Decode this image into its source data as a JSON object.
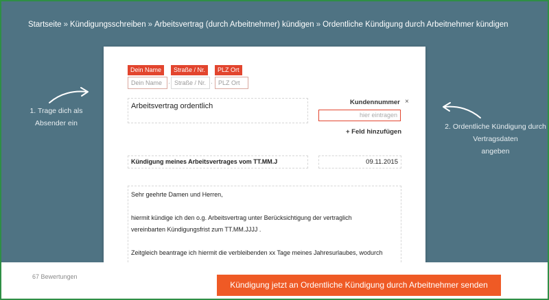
{
  "breadcrumb": {
    "items": [
      "Startseite",
      "Kündigungsschreiben",
      "Arbeitsvertrag (durch Arbeitnehmer) kündigen",
      "Ordentliche Kündigung durch Arbeitnehmer kündigen"
    ],
    "separator": "»"
  },
  "notes": {
    "left": [
      "1. Trage dich als",
      "Absender ein"
    ],
    "right": [
      "2. Ordentliche Kündigung durch",
      "Vertragsdaten",
      "angeben"
    ]
  },
  "sender": {
    "chips": [
      "Dein Name",
      "Straße / Nr.",
      "PLZ Ort"
    ],
    "placeholders": [
      "Dein Name",
      "Straße / Nr.",
      "PLZ Ort"
    ],
    "dot": "·"
  },
  "letter": {
    "subject_title": "Arbeitsvertrag ordentlich",
    "kunden_label": "Kundennummer",
    "kunden_close": "×",
    "kunden_placeholder": "hier eintragen",
    "add_field": "+ Feld hinzufügen",
    "subject": "Kündigung meines Arbeitsvertrages vom TT.MM.J",
    "date": "09.11.2015",
    "body_lines": [
      "Sehr geehrte Damen und Herren,",
      "hiermit kündige ich den o.g.  Arbeitsvertrag unter Berücksichtigung der vertraglich",
      "vereinbarten Kündigungsfrist zum TT.MM.JJJJ .",
      "Zeitgleich beantrage ich hiermit die verbleibenden xx Tage meines Jahresurlaubes, wodurch"
    ]
  },
  "footer": {
    "rating": "67 Bewertungen",
    "send_button": "Kündigung jetzt an Ordentliche Kündigung durch Arbeitnehmer senden"
  },
  "colors": {
    "background": "#4f7383",
    "accent": "#e2452e",
    "button": "#ef5a25"
  }
}
